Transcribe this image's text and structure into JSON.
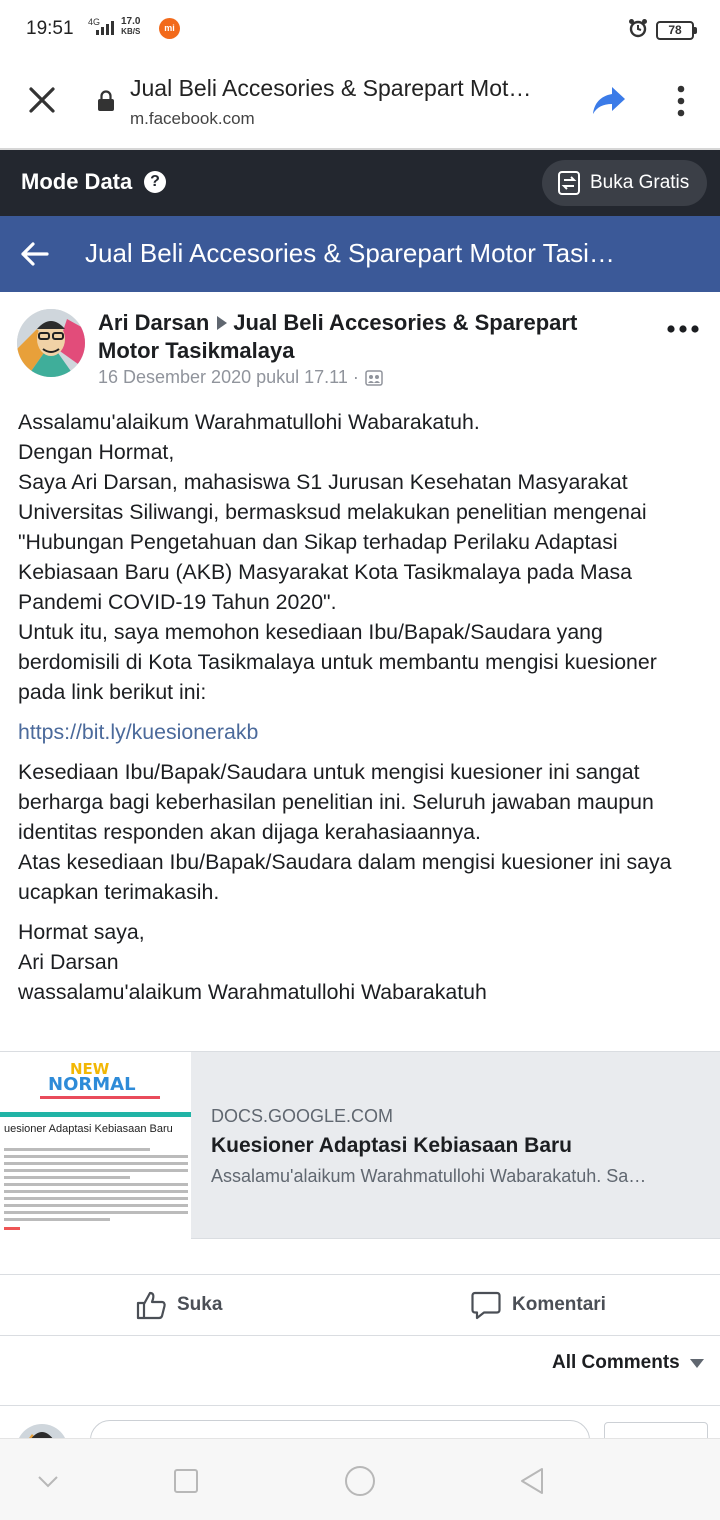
{
  "status_bar": {
    "time": "19:51",
    "network": "4G",
    "speed_value": "17.0",
    "speed_unit": "KB/S",
    "notification_icon": "mi-icon",
    "notification_text": "mi",
    "battery": "78"
  },
  "browser": {
    "title": "Jual Beli Accesories & Sparepart Mot…",
    "url": "m.facebook.com"
  },
  "mode_data": {
    "label": "Mode Data",
    "button_label": "Buka Gratis"
  },
  "group_header": {
    "title": "Jual Beli Accesories & Sparepart Motor Tasi…"
  },
  "post": {
    "author": "Ari Darsan",
    "group": "Jual Beli Accesories & Sparepart Motor Tasikmalaya",
    "timestamp": "16 Desember 2020 pukul 17.11 ·",
    "paragraphs": [
      "Assalamu'alaikum Warahmatullohi Wabarakatuh.\nDengan Hormat,\nSaya Ari Darsan, mahasiswa S1 Jurusan Kesehatan Masyarakat Universitas Siliwangi, bermasksud melakukan penelitian mengenai \"Hubungan Pengetahuan dan Sikap terhadap Perilaku Adaptasi Kebiasaan Baru (AKB) Masyarakat Kota Tasikmalaya pada Masa Pandemi COVID-19 Tahun 2020\".\nUntuk itu, saya memohon kesediaan Ibu/Bapak/Saudara yang berdomisili di Kota Tasikmalaya untuk membantu mengisi kuesioner pada link berikut ini:",
      "https://bit.ly/kuesionerakb",
      "Kesediaan Ibu/Bapak/Saudara untuk mengisi kuesioner ini sangat berharga bagi keberhasilan penelitian ini. Seluruh jawaban maupun identitas responden akan dijaga kerahasiaannya.\nAtas kesediaan Ibu/Bapak/Saudara dalam mengisi kuesioner ini saya ucapkan terimakasih.",
      "Hormat saya,\nAri Darsan\nwassalamu'alaikum Warahmatullohi Wabarakatuh"
    ]
  },
  "link_preview": {
    "domain": "DOCS.GOOGLE.COM",
    "title": "Kuesioner Adaptasi Kebiasaan Baru",
    "description": "Assalamu'alaikum Warahmatullohi Wabarakatuh. Sa…",
    "thumb_banner_line1": "NEW",
    "thumb_banner_line2": "NORMAL",
    "thumb_heading": "uesioner Adaptasi Kebiasaan Baru"
  },
  "actions": {
    "like": "Suka",
    "comment": "Komentari"
  },
  "comments": {
    "filter_label": "All Comments"
  },
  "colors": {
    "facebook_blue": "#3b5998",
    "mode_data_bg": "#23272f",
    "link": "#4b6a9b"
  }
}
